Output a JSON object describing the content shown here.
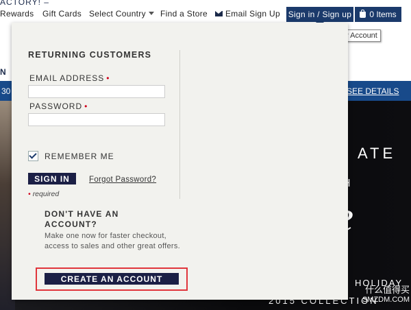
{
  "header": {
    "brand_fragment": "ACTORY! –",
    "nav": {
      "rewards": "Rewards",
      "gift_cards": "Gift Cards",
      "select_country": "Select Country",
      "find_store": "Find a Store",
      "email_signup": "Email Sign Up"
    },
    "signin_tab": "Sign in / Sign up",
    "bag_tab": "0 Items",
    "tooltip": "My Account"
  },
  "background": {
    "nav_partial": "N",
    "promo_left": "30",
    "promo_right": "SEE DETAILS",
    "hero": {
      "line1": "ATE",
      "line2": "H",
      "script": "le",
      "line3": "HOLIDAY",
      "line4": "2015 COLLECTION"
    }
  },
  "signin_panel": {
    "heading": "RETURNING CUSTOMERS",
    "email_label": "EMAIL ADDRESS",
    "email_value": "",
    "password_label": "PASSWORD",
    "password_value": "",
    "required_star": "•",
    "remember_me": {
      "label": "REMEMBER ME",
      "checked": true
    },
    "signin_button": "SIGN IN",
    "forgot_password": "Forgot Password?",
    "required_note": "required",
    "new_account": {
      "heading": "DON'T HAVE AN ACCOUNT?",
      "description": "Make one now for faster checkout, access to sales and other great offers.",
      "button": "CREATE AN ACCOUNT"
    }
  },
  "watermark": {
    "cn": "什么值得买",
    "url": "SMZDM.COM"
  },
  "colors": {
    "navy": "#1b3a6b",
    "button": "#1b1f45",
    "promo": "#184a8a",
    "highlight": "#e0343a",
    "required": "#d0021b"
  }
}
